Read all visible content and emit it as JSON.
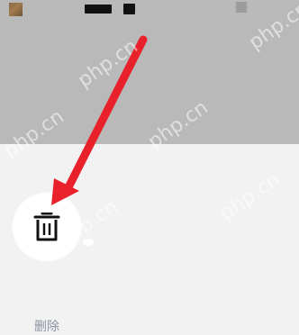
{
  "actions": [
    {
      "label": "删除",
      "icon": "trash-icon"
    }
  ],
  "watermark": {
    "text": "php.cn"
  },
  "annotation": {
    "type": "red-arrow",
    "color": "#e8212a"
  }
}
